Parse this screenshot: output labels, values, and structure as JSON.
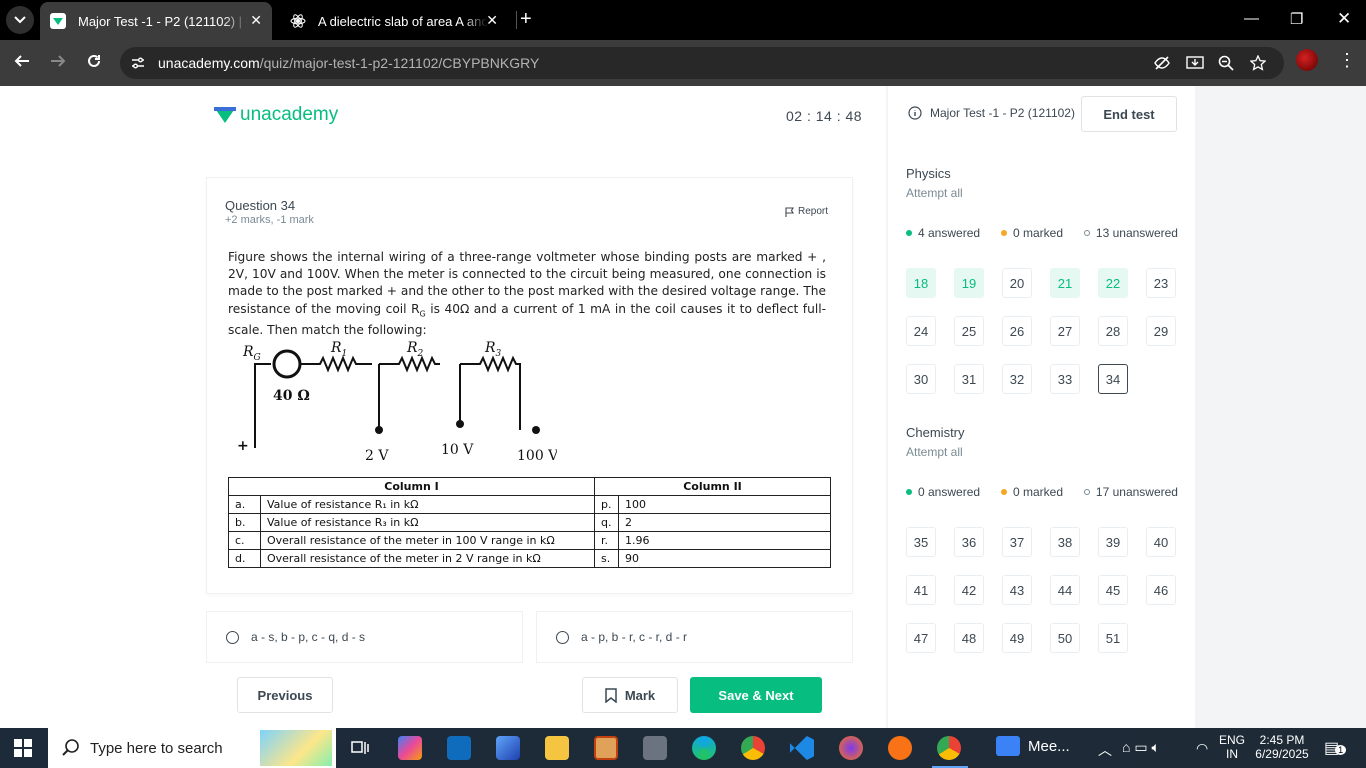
{
  "browser": {
    "tabs": [
      {
        "title": "Major Test -1 - P2 (121102) | Unacademy",
        "active": true
      },
      {
        "title": "A dielectric slab of area A and thickness",
        "active": false
      }
    ],
    "url_host": "unacademy.com",
    "url_path": "/quiz/major-test-1-p2-121102/CBYPBNKGRY"
  },
  "header": {
    "logo_text": "unacademy",
    "timer": "02 : 14 : 48"
  },
  "question": {
    "number_label": "Question 34",
    "marks": "+2 marks, -1 mark",
    "report_label": "Report",
    "text": "Figure shows the internal wiring of a three-range voltmeter whose binding posts are marked + , 2V, 10V and 100V. When the meter is connected to the circuit being measured, one connection is made to the post marked + and the other to the post marked with the desired voltage range. The resistance of the moving coil R",
    "text_sub": "G",
    "text_rest": " is 40Ω and a current of 1 mA in the coil causes it to deflect full-scale. Then match the following:",
    "circuit": {
      "rg": "R",
      "rg_sub": "G",
      "r1": "R",
      "r1_sub": "1",
      "r2": "R",
      "r2_sub": "2",
      "r3": "R",
      "r3_sub": "3",
      "coil": "40 Ω",
      "plus": "+",
      "v2": "2 V",
      "v10": "10 V",
      "v100": "100 V"
    },
    "table": {
      "col1": "Column I",
      "col2": "Column II",
      "rows": [
        {
          "k": "a.",
          "left": "Value of resistance R₁ in kΩ",
          "p": "p.",
          "right": "100"
        },
        {
          "k": "b.",
          "left": "Value of resistance R₃ in kΩ",
          "p": "q.",
          "right": "2"
        },
        {
          "k": "c.",
          "left": "Overall resistance of the meter in 100 V range in kΩ",
          "p": "r.",
          "right": "1.96"
        },
        {
          "k": "d.",
          "left": "Overall resistance of the meter in 2 V range in kΩ",
          "p": "s.",
          "right": "90"
        }
      ]
    }
  },
  "options": [
    "a - s, b - p, c - q, d - s",
    "a - p, b - r, c - r, d - r"
  ],
  "footer": {
    "previous": "Previous",
    "mark": "Mark",
    "save_next": "Save & Next"
  },
  "sidebar": {
    "test_name": "Major Test -1 - P2 (121102)",
    "end_test": "End test",
    "sections": [
      {
        "name": "Physics",
        "attempt": "Attempt all",
        "answered": "4 answered",
        "marked": "0 marked",
        "unanswered": "13 unanswered",
        "questions": [
          {
            "n": "18",
            "state": "answered"
          },
          {
            "n": "19",
            "state": "answered"
          },
          {
            "n": "20",
            "state": "none"
          },
          {
            "n": "21",
            "state": "answered"
          },
          {
            "n": "22",
            "state": "answered"
          },
          {
            "n": "23",
            "state": "none"
          },
          {
            "n": "24",
            "state": "none"
          },
          {
            "n": "25",
            "state": "none"
          },
          {
            "n": "26",
            "state": "none"
          },
          {
            "n": "27",
            "state": "none"
          },
          {
            "n": "28",
            "state": "none"
          },
          {
            "n": "29",
            "state": "none"
          },
          {
            "n": "30",
            "state": "none"
          },
          {
            "n": "31",
            "state": "none"
          },
          {
            "n": "32",
            "state": "none"
          },
          {
            "n": "33",
            "state": "none"
          },
          {
            "n": "34",
            "state": "current"
          }
        ]
      },
      {
        "name": "Chemistry",
        "attempt": "Attempt all",
        "answered": "0 answered",
        "marked": "0 marked",
        "unanswered": "17 unanswered",
        "questions": [
          {
            "n": "35",
            "state": "none"
          },
          {
            "n": "36",
            "state": "none"
          },
          {
            "n": "37",
            "state": "none"
          },
          {
            "n": "38",
            "state": "none"
          },
          {
            "n": "39",
            "state": "none"
          },
          {
            "n": "40",
            "state": "none"
          },
          {
            "n": "41",
            "state": "none"
          },
          {
            "n": "42",
            "state": "none"
          },
          {
            "n": "43",
            "state": "none"
          },
          {
            "n": "44",
            "state": "none"
          },
          {
            "n": "45",
            "state": "none"
          },
          {
            "n": "46",
            "state": "none"
          },
          {
            "n": "47",
            "state": "none"
          },
          {
            "n": "48",
            "state": "none"
          },
          {
            "n": "49",
            "state": "none"
          },
          {
            "n": "50",
            "state": "none"
          },
          {
            "n": "51",
            "state": "none"
          }
        ]
      }
    ]
  },
  "colors": {
    "brand": "#08bd80",
    "answered_dot": "#08bd80",
    "marked_dot": "#f5a623"
  },
  "taskbar": {
    "search_placeholder": "Type here to search",
    "meet_label": "Mee...",
    "lang": "ENG",
    "region": "IN",
    "time": "2:45 PM",
    "date": "6/29/2025",
    "notif_count": "1"
  }
}
